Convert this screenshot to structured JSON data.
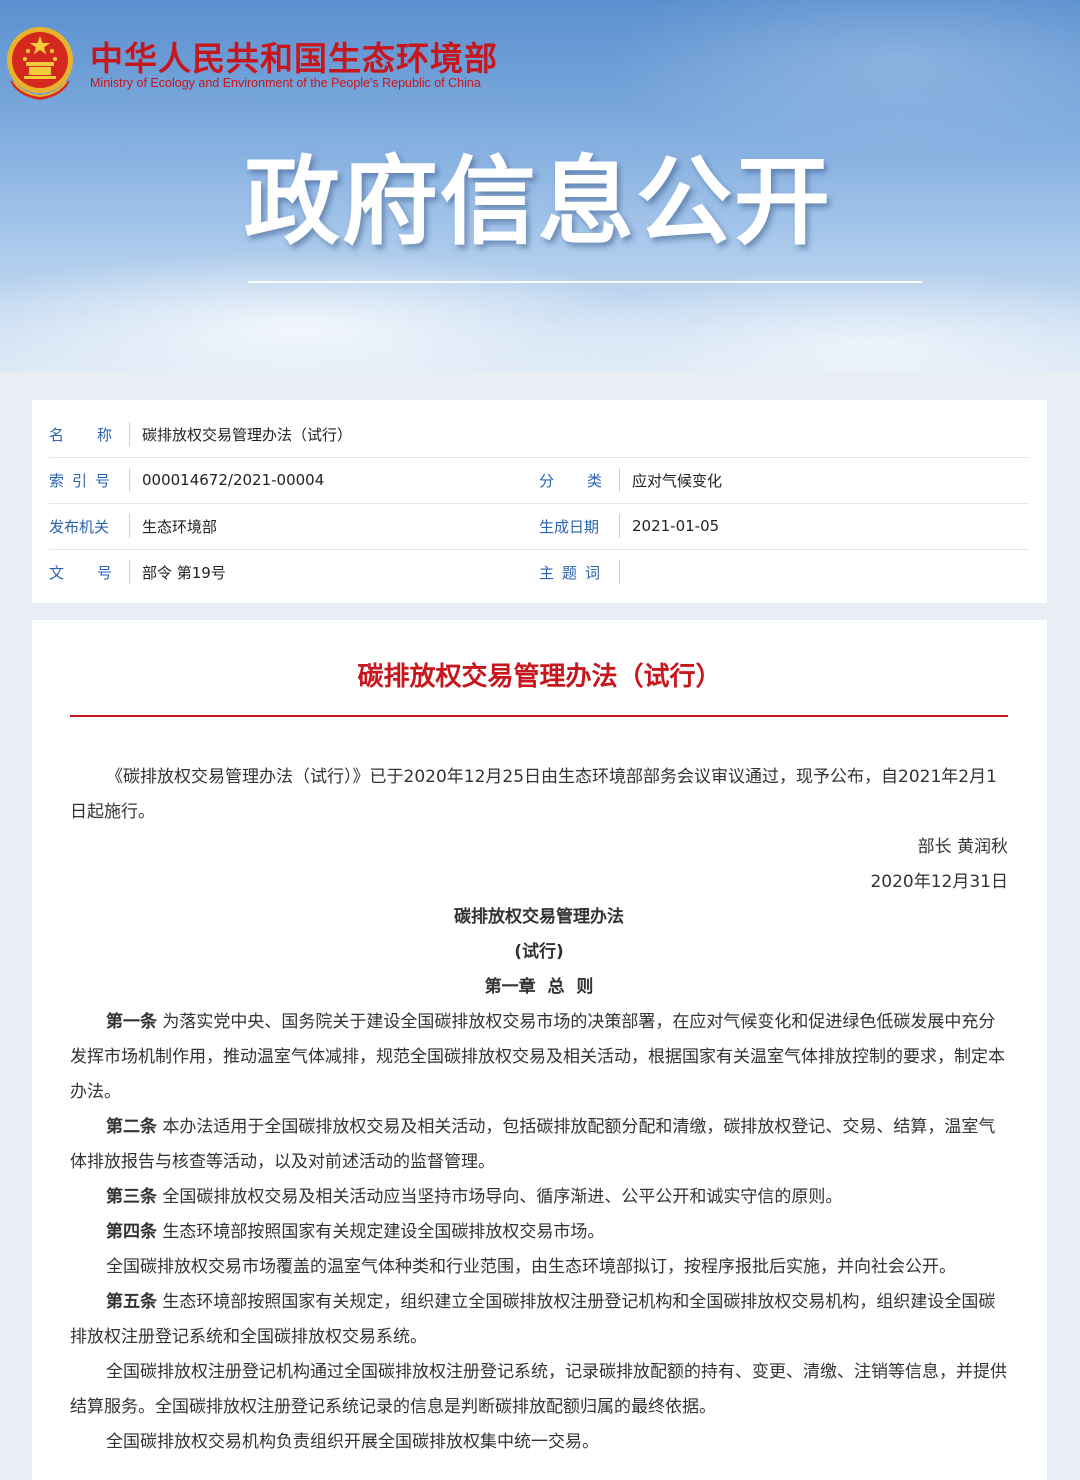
{
  "header": {
    "ministry_cn": "中华人民共和国生态环境部",
    "ministry_en": "Ministry of Ecology and Environment of the People's Republic of China",
    "banner_title": "政府信息公开"
  },
  "meta": {
    "name_label": "名称",
    "name_value": "碳排放权交易管理办法（试行）",
    "index_label": "索引号",
    "index_value": "000014672/2021-00004",
    "category_label": "分类",
    "category_value": "应对气候变化",
    "issuer_label": "发布机关",
    "issuer_value": "生态环境部",
    "date_label": "生成日期",
    "date_value": "2021-01-05",
    "docno_label": "文号",
    "docno_value": "部令 第19号",
    "topic_label": "主题词",
    "topic_value": ""
  },
  "article": {
    "title": "碳排放权交易管理办法（试行）",
    "intro": "《碳排放权交易管理办法（试行）》已于2020年12月25日由生态环境部部务会议审议通过，现予公布，自2021年2月1日起施行。",
    "signature": "部长 黄润秋",
    "sign_date": "2020年12月31日",
    "doc_heading": "碳排放权交易管理办法",
    "doc_subheading": "(试行)",
    "chapter": "第一章  总  则",
    "a1_num": "第一条",
    "a1_text": "为落实党中央、国务院关于建设全国碳排放权交易市场的决策部署，在应对气候变化和促进绿色低碳发展中充分发挥市场机制作用，推动温室气体减排，规范全国碳排放权交易及相关活动，根据国家有关温室气体排放控制的要求，制定本办法。",
    "a2_num": "第二条",
    "a2_text": "本办法适用于全国碳排放权交易及相关活动，包括碳排放配额分配和清缴，碳排放权登记、交易、结算，温室气体排放报告与核查等活动，以及对前述活动的监督管理。",
    "a3_num": "第三条",
    "a3_text": "全国碳排放权交易及相关活动应当坚持市场导向、循序渐进、公平公开和诚实守信的原则。",
    "a4_num": "第四条",
    "a4_text": "生态环境部按照国家有关规定建设全国碳排放权交易市场。",
    "a4_para2": "全国碳排放权交易市场覆盖的温室气体种类和行业范围，由生态环境部拟订，按程序报批后实施，并向社会公开。",
    "a5_num": "第五条",
    "a5_text": "生态环境部按照国家有关规定，组织建立全国碳排放权注册登记机构和全国碳排放权交易机构，组织建设全国碳排放权注册登记系统和全国碳排放权交易系统。",
    "a5_para2": "全国碳排放权注册登记机构通过全国碳排放权注册登记系统，记录碳排放配额的持有、变更、清缴、注销等信息，并提供结算服务。全国碳排放权注册登记系统记录的信息是判断碳排放配额归属的最终依据。",
    "a5_para3": "全国碳排放权交易机构负责组织开展全国碳排放权集中统一交易。"
  }
}
